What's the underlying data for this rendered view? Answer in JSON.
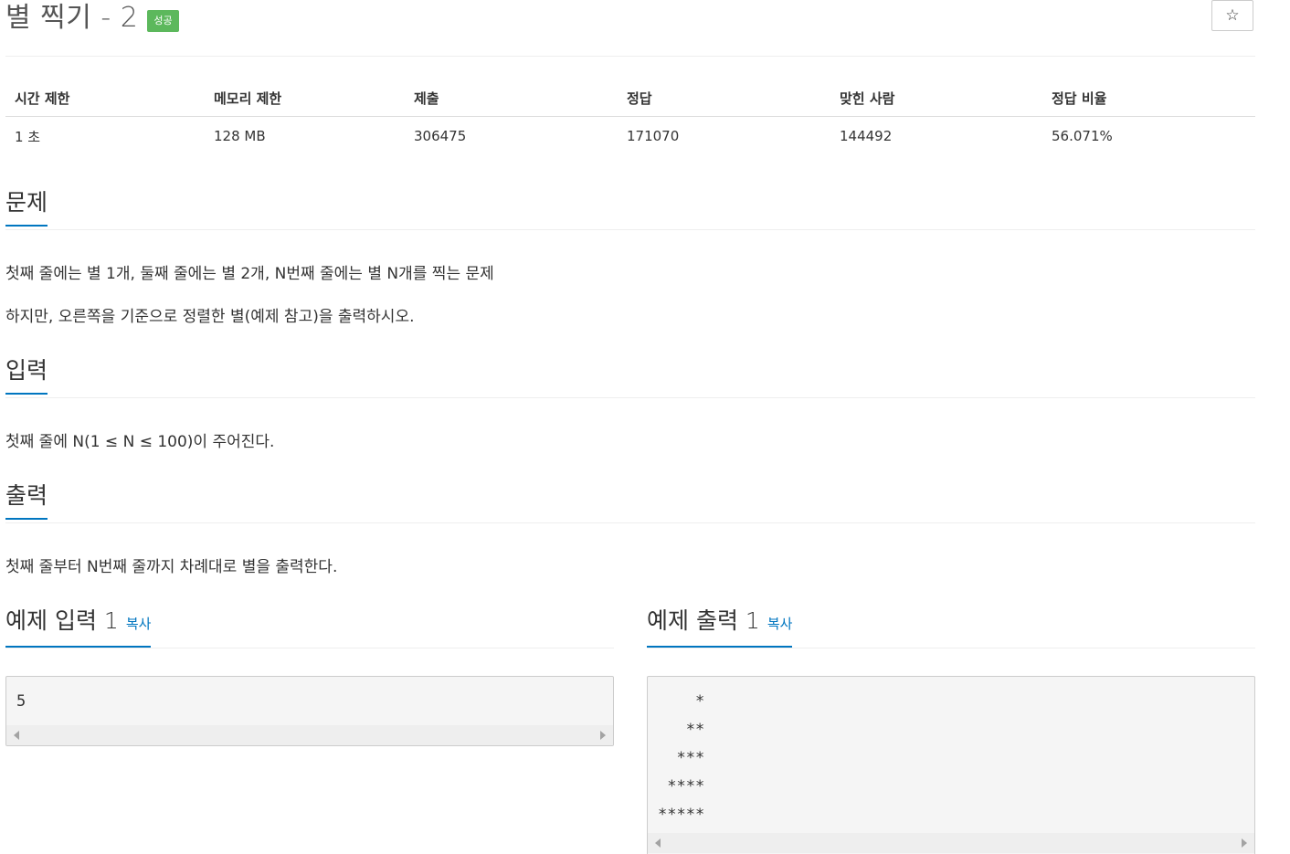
{
  "problem": {
    "title": "별 찍기 - 2",
    "status_badge": "성공",
    "star_icon": "☆"
  },
  "info_table": {
    "headers": [
      "시간 제한",
      "메모리 제한",
      "제출",
      "정답",
      "맞힌 사람",
      "정답 비율"
    ],
    "values": [
      "1 초",
      "128 MB",
      "306475",
      "171070",
      "144492",
      "56.071%"
    ]
  },
  "sections": {
    "problem": {
      "heading": "문제",
      "lines": [
        "첫째 줄에는 별 1개, 둘째 줄에는 별 2개, N번째 줄에는 별 N개를 찍는 문제",
        "하지만, 오른쪽을 기준으로 정렬한 별(예제 참고)을 출력하시오."
      ]
    },
    "input": {
      "heading": "입력",
      "lines": [
        "첫째 줄에 N(1 ≤ N ≤ 100)이 주어진다."
      ]
    },
    "output": {
      "heading": "출력",
      "lines": [
        "첫째 줄부터 N번째 줄까지 차례대로 별을 출력한다."
      ]
    }
  },
  "samples": {
    "input": {
      "heading": "예제 입력 1",
      "copy_label": "복사",
      "content": "5"
    },
    "output": {
      "heading": "예제 출력 1",
      "copy_label": "복사",
      "content": "    *\n   **\n  ***\n ****\n*****"
    }
  },
  "colors": {
    "accent": "#0076c0",
    "success": "#5cb85c"
  }
}
